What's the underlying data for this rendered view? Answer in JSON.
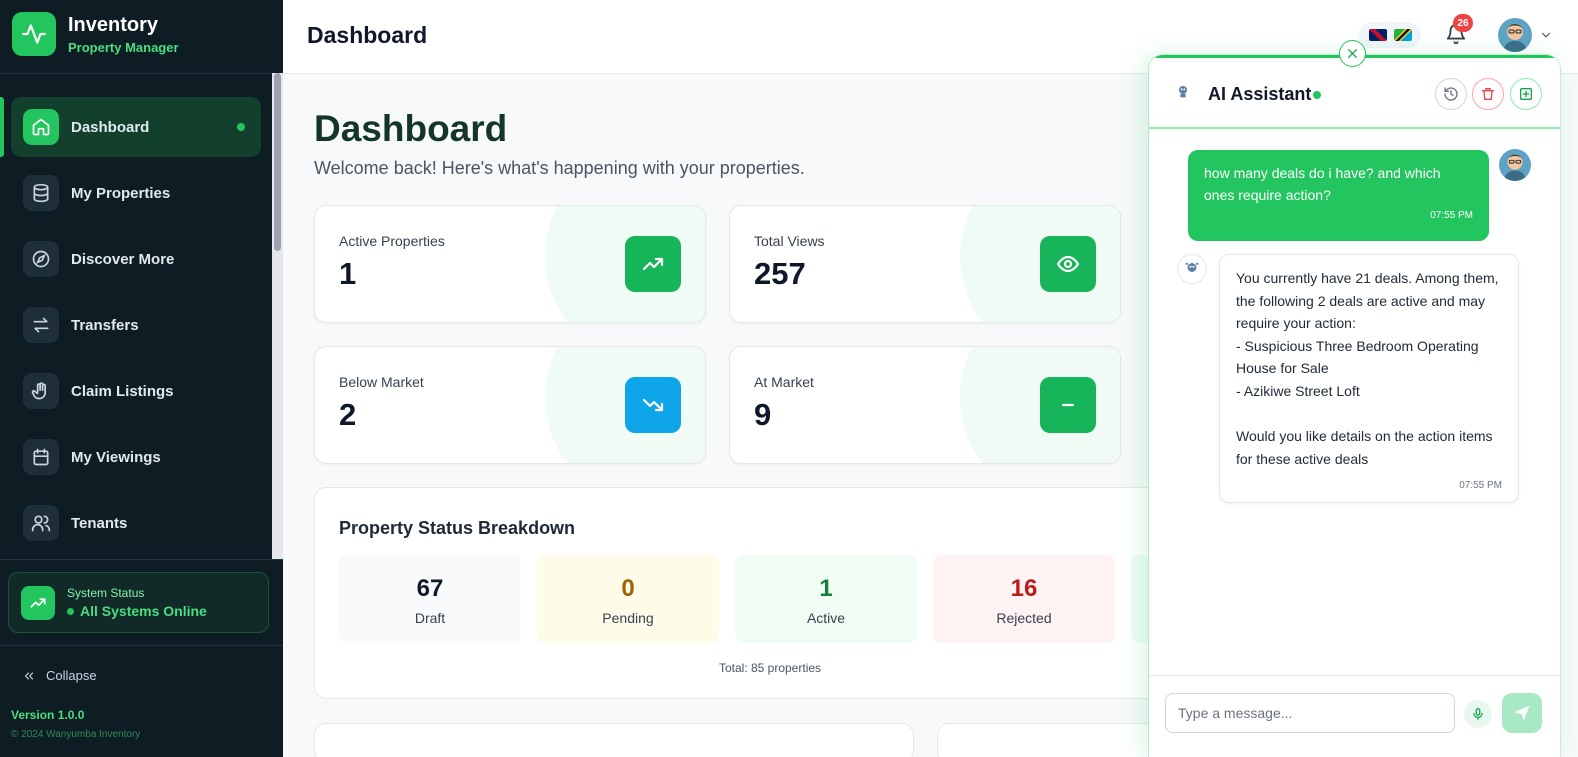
{
  "brand": {
    "title": "Inventory",
    "subtitle": "Property Manager"
  },
  "sidebar": {
    "items": [
      {
        "label": "Dashboard",
        "icon": "home-icon",
        "active": true
      },
      {
        "label": "My Properties",
        "icon": "database-icon"
      },
      {
        "label": "Discover More",
        "icon": "compass-icon"
      },
      {
        "label": "Transfers",
        "icon": "transfer-arrows-icon"
      },
      {
        "label": "Claim Listings",
        "icon": "hand-icon"
      },
      {
        "label": "My Viewings",
        "icon": "calendar-icon"
      },
      {
        "label": "Tenants",
        "icon": "users-icon"
      }
    ],
    "system_status": {
      "label": "System Status",
      "value": "All Systems Online"
    },
    "collapse_label": "Collapse",
    "version": "Version 1.0.0",
    "copyright": "© 2024 Wanyumba Inventory"
  },
  "header": {
    "title": "Dashboard",
    "notification_count": "26"
  },
  "main": {
    "title": "Dashboard",
    "subtitle": "Welcome back! Here's what's happening with your properties.",
    "stats": [
      {
        "label": "Active Properties",
        "value": "1",
        "icon": "trend-up-icon"
      },
      {
        "label": "Total Views",
        "value": "257",
        "icon": "eye-icon"
      },
      {
        "label": "Below Market",
        "value": "2",
        "icon": "trend-down-icon"
      },
      {
        "label": "At Market",
        "value": "9",
        "icon": "minus-icon"
      }
    ],
    "breakdown": {
      "title": "Property Status Breakdown",
      "statuses": [
        {
          "value": "67",
          "label": "Draft"
        },
        {
          "value": "0",
          "label": "Pending"
        },
        {
          "value": "1",
          "label": "Active"
        },
        {
          "value": "16",
          "label": "Rejected"
        }
      ],
      "total": "Total: 85 properties"
    }
  },
  "chat": {
    "title": "AI Assistant",
    "user_message": {
      "text": "how many deals do i have? and which ones require action?",
      "time": "07:55 PM"
    },
    "bot_message": {
      "lines": [
        "You currently have 21 deals. Among them,",
        "the following 2 deals are active and may",
        "require your action:",
        "- Suspicious Three Bedroom Operating",
        "House for Sale",
        "- Azikiwe Street Loft",
        "",
        "Would you like details on the action items",
        "for these active deals"
      ],
      "time": "07:55 PM"
    },
    "input_placeholder": "Type a message..."
  },
  "colors": {
    "accent": "#22c55e",
    "sidebar_bg": "#0e1c24",
    "badge": "#ef4444"
  }
}
